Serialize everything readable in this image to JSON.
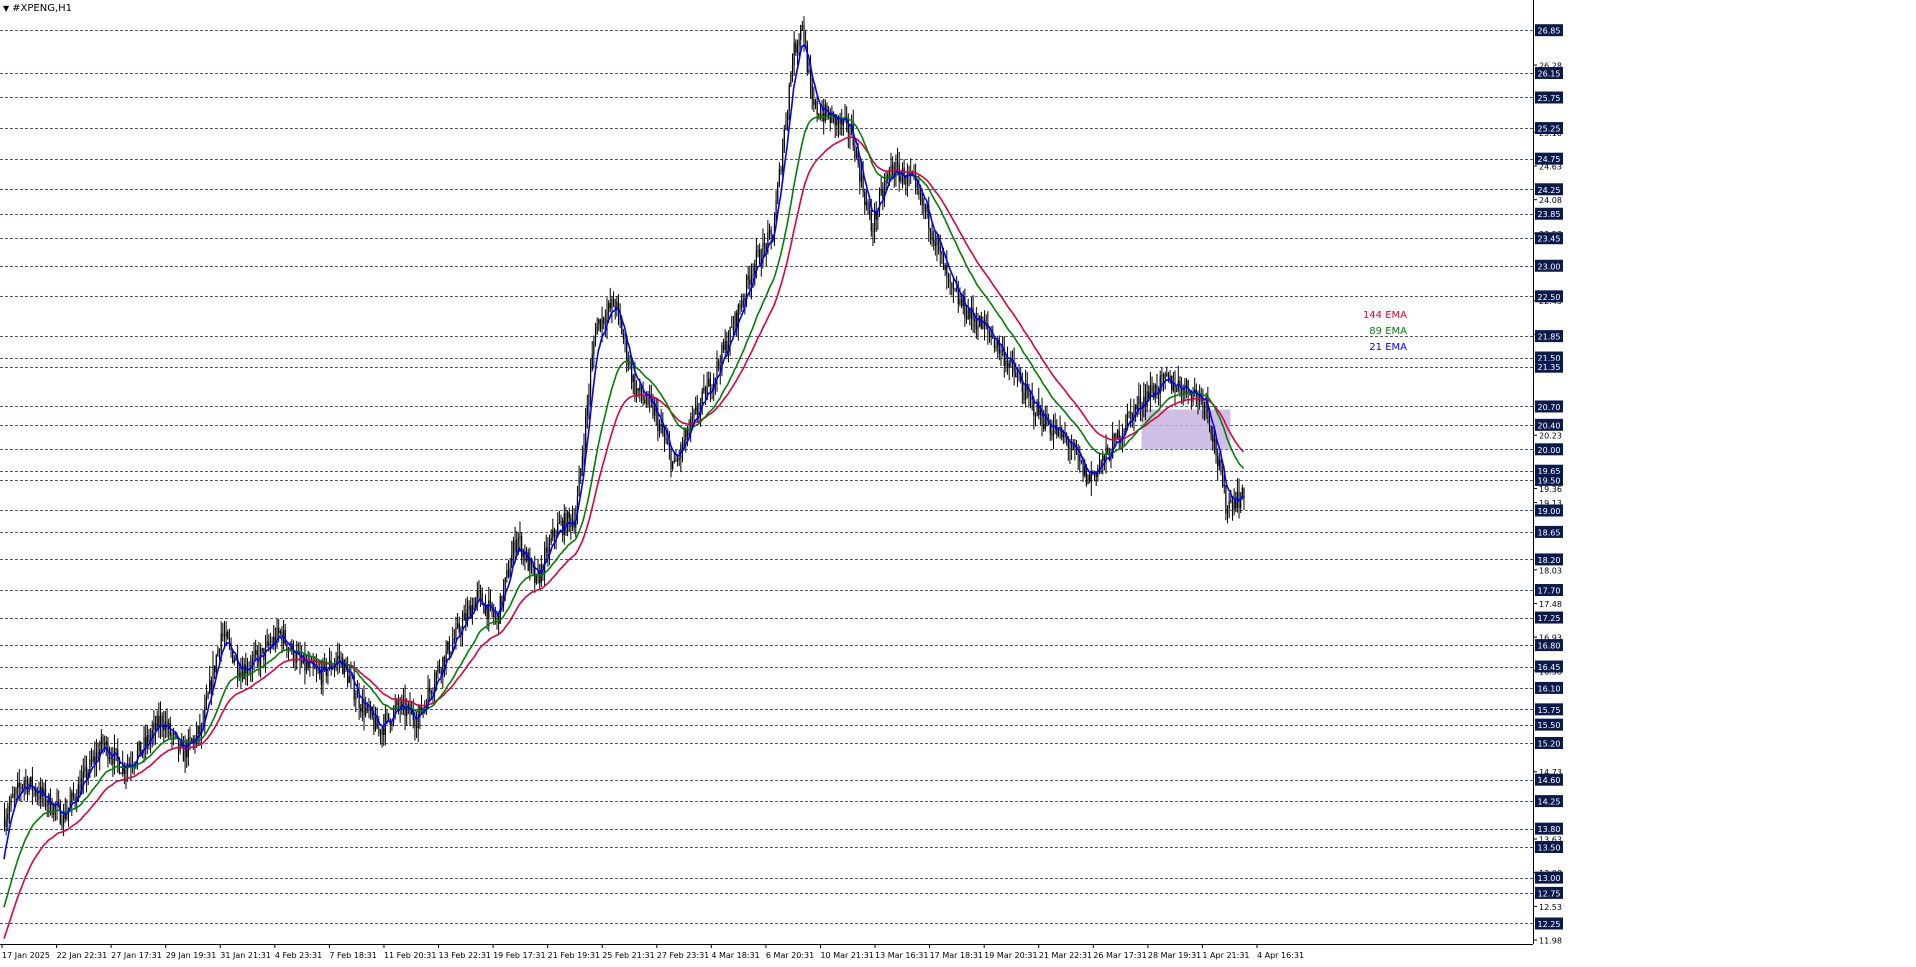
{
  "window": {
    "title": "#XPENG,H1",
    "menu_icon": "triangle-down-icon"
  },
  "colors": {
    "background": "#ffffff",
    "grid": "#1a1a4a",
    "candles": "#000000",
    "price_label_bg": "#0b1a4d",
    "price_label_text": "#ffffff",
    "ema21": "#0000ff",
    "ema89": "#008000",
    "ema144": "#e00040",
    "zone": "#c8b4e0"
  },
  "chart_data": {
    "type": "candlestick",
    "symbol": "#XPENG",
    "timeframe": "H1",
    "grid": true,
    "ylim": [
      11.98,
      27.18
    ],
    "y_ticks_highlighted": [
      "26.85",
      "26.15",
      "25.75",
      "25.25",
      "24.75",
      "24.25",
      "23.85",
      "23.45",
      "23.00",
      "22.50",
      "21.85",
      "21.50",
      "21.35",
      "20.70",
      "20.40",
      "20.00",
      "19.65",
      "19.50",
      "19.00",
      "18.65",
      "18.20",
      "17.70",
      "17.25",
      "16.80",
      "16.45",
      "16.10",
      "15.75",
      "15.50",
      "15.20",
      "14.60",
      "14.25",
      "13.80",
      "13.50",
      "13.00",
      "12.75",
      "12.25"
    ],
    "y_ticks_plain": [
      "26.28",
      "25.18",
      "24.63",
      "24.08",
      "23.53",
      "22.43",
      "21.88",
      "20.23",
      "19.36",
      "19.13",
      "18.03",
      "17.48",
      "16.93",
      "16.38",
      "14.73",
      "13.63",
      "13.08",
      "12.53",
      "11.98"
    ],
    "x_ticks": [
      "17 Jan 2025",
      "22 Jan 22:31",
      "27 Jan 17:31",
      "29 Jan 19:31",
      "31 Jan 21:31",
      "4 Feb 23:31",
      "7 Feb 18:31",
      "11 Feb 20:31",
      "13 Feb 22:31",
      "19 Feb 17:31",
      "21 Feb 19:31",
      "25 Feb 21:31",
      "27 Feb 23:31",
      "4 Mar 18:31",
      "6 Mar 20:31",
      "10 Mar 21:31",
      "13 Mar 16:31",
      "17 Mar 18:31",
      "19 Mar 20:31",
      "21 Mar 22:31",
      "26 Mar 17:31",
      "28 Mar 19:31",
      "1 Apr 21:31",
      "4 Apr 16:31"
    ],
    "price_path": [
      [
        0,
        14.0
      ],
      [
        2,
        14.6
      ],
      [
        4,
        14.3
      ],
      [
        6,
        14.0
      ],
      [
        8,
        14.6
      ],
      [
        10,
        15.2
      ],
      [
        12,
        14.8
      ],
      [
        14,
        15.1
      ],
      [
        16,
        15.6
      ],
      [
        18,
        15.0
      ],
      [
        20,
        15.4
      ],
      [
        22,
        17.0
      ],
      [
        24,
        16.4
      ],
      [
        26,
        16.6
      ],
      [
        28,
        17.0
      ],
      [
        30,
        16.5
      ],
      [
        32,
        16.3
      ],
      [
        34,
        16.6
      ],
      [
        36,
        15.9
      ],
      [
        38,
        15.4
      ],
      [
        40,
        15.8
      ],
      [
        42,
        15.6
      ],
      [
        44,
        16.4
      ],
      [
        46,
        17.0
      ],
      [
        48,
        17.6
      ],
      [
        50,
        17.2
      ],
      [
        52,
        18.6
      ],
      [
        54,
        17.8
      ],
      [
        56,
        18.7
      ],
      [
        58,
        18.9
      ],
      [
        60,
        22.0
      ],
      [
        62,
        22.4
      ],
      [
        64,
        21.0
      ],
      [
        66,
        20.6
      ],
      [
        68,
        19.7
      ],
      [
        70,
        20.5
      ],
      [
        72,
        21.2
      ],
      [
        74,
        22.0
      ],
      [
        76,
        23.0
      ],
      [
        78,
        23.5
      ],
      [
        80,
        26.4
      ],
      [
        81,
        27.0
      ],
      [
        82,
        25.6
      ],
      [
        84,
        25.4
      ],
      [
        86,
        25.2
      ],
      [
        88,
        23.6
      ],
      [
        90,
        24.6
      ],
      [
        92,
        24.4
      ],
      [
        94,
        23.7
      ],
      [
        96,
        22.6
      ],
      [
        98,
        22.2
      ],
      [
        100,
        21.9
      ],
      [
        102,
        21.4
      ],
      [
        104,
        20.8
      ],
      [
        106,
        20.4
      ],
      [
        108,
        20.1
      ],
      [
        110,
        19.5
      ],
      [
        112,
        19.9
      ],
      [
        114,
        20.5
      ],
      [
        116,
        20.9
      ],
      [
        118,
        21.1
      ],
      [
        120,
        21.0
      ],
      [
        122,
        20.8
      ],
      [
        124,
        19.1
      ],
      [
        125,
        19.2
      ]
    ],
    "gap_sessions": [
      [
        113,
        114
      ],
      [
        122,
        123
      ]
    ],
    "indicators": [
      {
        "name": "144 EMA",
        "color": "#e00040",
        "period": 144
      },
      {
        "name": "89 EMA",
        "color": "#008000",
        "period": 89
      },
      {
        "name": "21 EMA",
        "color": "#0000ff",
        "period": 21
      }
    ],
    "zone": {
      "y_top": 20.65,
      "y_bottom": 20.0,
      "x_start": 115.5,
      "x_end": 124.5
    }
  }
}
